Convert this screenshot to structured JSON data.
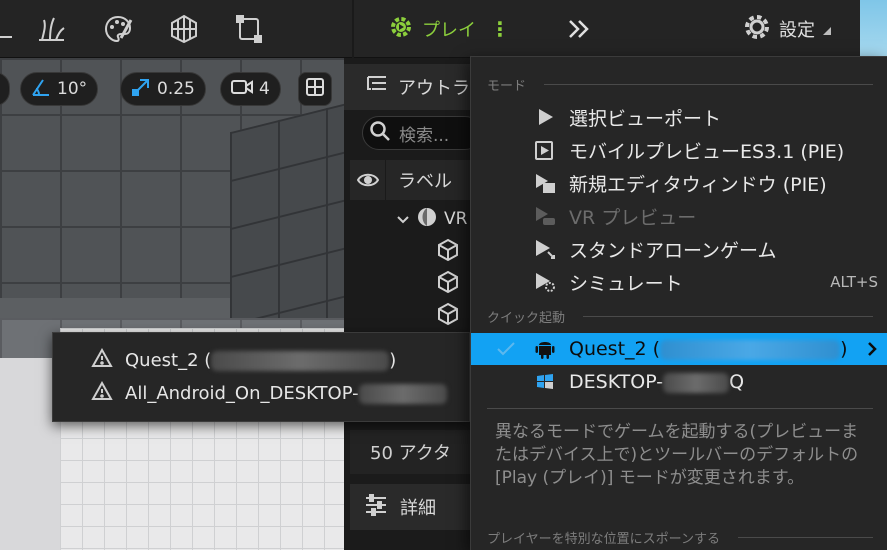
{
  "toolbar": {
    "icons": [
      "mode-select-icon",
      "foliage-icon",
      "paint-icon",
      "landscape-icon",
      "modeling-icon"
    ],
    "play_label": "プレイ",
    "more_glyph": "⋮",
    "expand_glyph": "»",
    "settings_label": "設定",
    "accent_color": "#8ccf3c"
  },
  "viewport": {
    "angle_snap": "10°",
    "scale_snap": "0.25",
    "camera_speed": "4"
  },
  "outliner": {
    "title": "アウトラ",
    "search_placeholder": "検索...",
    "column_label": "ラベル",
    "root_label": "VR",
    "actor_count": "50 アクタ",
    "details_title": "詳細"
  },
  "submenu": {
    "items": [
      {
        "label_prefix": "Quest_2 (",
        "label_suffix": ")"
      },
      {
        "label_prefix": "All_Android_On_DESKTOP-",
        "label_suffix": ""
      }
    ]
  },
  "menu": {
    "section_mode": "モード",
    "modes": [
      {
        "label": "選択ビューポート",
        "icon": "play-viewport-icon",
        "enabled": true
      },
      {
        "label": "モバイルプレビューES3.1 (PIE)",
        "icon": "mobile-preview-icon",
        "enabled": true
      },
      {
        "label": "新規エディタウィンドウ (PIE)",
        "icon": "new-window-icon",
        "enabled": true
      },
      {
        "label": "VR プレビュー",
        "icon": "vr-preview-icon",
        "enabled": false
      },
      {
        "label": "スタンドアローンゲーム",
        "icon": "standalone-icon",
        "enabled": true
      },
      {
        "label": "シミュレート",
        "icon": "simulate-icon",
        "enabled": true,
        "shortcut": "ALT+S"
      }
    ],
    "section_quick": "クイック起動",
    "quick": [
      {
        "label_prefix": "Quest_2 (",
        "label_suffix": ")",
        "icon": "android-icon",
        "selected": true
      },
      {
        "label_prefix": "DESKTOP-",
        "label_suffix": "Q",
        "icon": "windows-icon",
        "selected": false
      }
    ],
    "description": "異なるモードでゲームを起動する(プレビューまたはデバイス上で)とツールバーのデフォルトの[Play (プレイ)] モードが変更されます。",
    "section_spawn": "プレイヤーを特別な位置にスポーンする",
    "highlight_color": "#12a2f3"
  }
}
